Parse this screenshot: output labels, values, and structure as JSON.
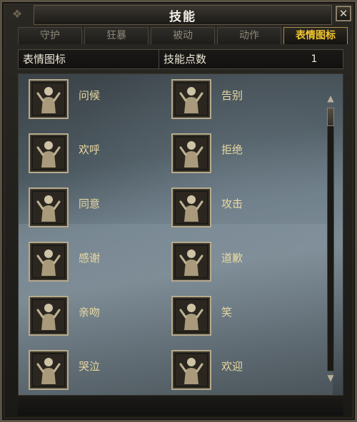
{
  "window": {
    "title": "技能"
  },
  "tabs": [
    {
      "label": "守护",
      "active": false
    },
    {
      "label": "狂暴",
      "active": false
    },
    {
      "label": "被动",
      "active": false
    },
    {
      "label": "动作",
      "active": false
    },
    {
      "label": "表情图标",
      "active": true
    }
  ],
  "info": {
    "category": "表情图标",
    "points_label": "技能点数",
    "points_value": "1"
  },
  "emotes": [
    {
      "label": "问候",
      "icon": "greeting-emote-icon"
    },
    {
      "label": "告别",
      "icon": "farewell-emote-icon"
    },
    {
      "label": "欢呼",
      "icon": "cheer-emote-icon"
    },
    {
      "label": "拒绝",
      "icon": "refuse-emote-icon"
    },
    {
      "label": "同意",
      "icon": "agree-emote-icon"
    },
    {
      "label": "攻击",
      "icon": "attack-emote-icon"
    },
    {
      "label": "感谢",
      "icon": "thanks-emote-icon"
    },
    {
      "label": "道歉",
      "icon": "apology-emote-icon"
    },
    {
      "label": "亲吻",
      "icon": "kiss-emote-icon"
    },
    {
      "label": "笑",
      "icon": "laugh-emote-icon"
    },
    {
      "label": "哭泣",
      "icon": "cry-emote-icon"
    },
    {
      "label": "欢迎",
      "icon": "welcome-emote-icon"
    }
  ],
  "close_glyph": "✕",
  "scroll": {
    "up_glyph": "▲",
    "down_glyph": "▼"
  },
  "colors": {
    "active_tab": "#f2c531",
    "item_label": "#ead9a2",
    "title": "#f2efe6"
  }
}
